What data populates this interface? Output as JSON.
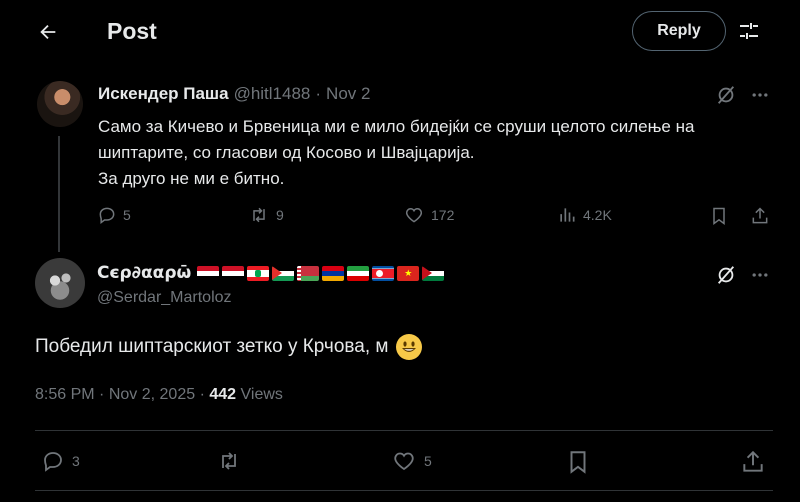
{
  "header": {
    "title": "Post",
    "reply_label": "Reply",
    "back_icon": "arrow-left-icon",
    "filter_icon": "sliders-icon"
  },
  "parent_tweet": {
    "display_name": "Искендер Паша",
    "handle": "@hitl1488",
    "separator": "·",
    "date": "Nov 2",
    "text_lines": [
      "Само за Кичево и Брвеница ми е мило бидејќи се сруши целото силење на",
      "шиптарите, со гласови од Косово и Швајцарија.",
      "За друго не ми е битно."
    ],
    "replies": "5",
    "reposts": "9",
    "likes": "172",
    "views": "4.2K"
  },
  "main_tweet": {
    "display_name": "Ϲєρ∂ααρω̄",
    "handle": "@Serdar_Martoloz",
    "flags": [
      "egypt",
      "syria",
      "lebanon",
      "palestine",
      "belarus",
      "armenia",
      "iran",
      "north-korea",
      "vietnam",
      "western-sahara"
    ],
    "text": "Победил шиптарскиот зетко у Крчова, м",
    "time": "8:56 PM",
    "separator": "·",
    "date": "Nov 2, 2025",
    "views_count": "442",
    "views_label": "Views",
    "replies": "3",
    "reposts": "",
    "likes": "5"
  },
  "colors": {
    "background": "#000000",
    "text_primary": "#e7e9ea",
    "text_secondary": "#71767b",
    "divider": "#2f3336"
  }
}
